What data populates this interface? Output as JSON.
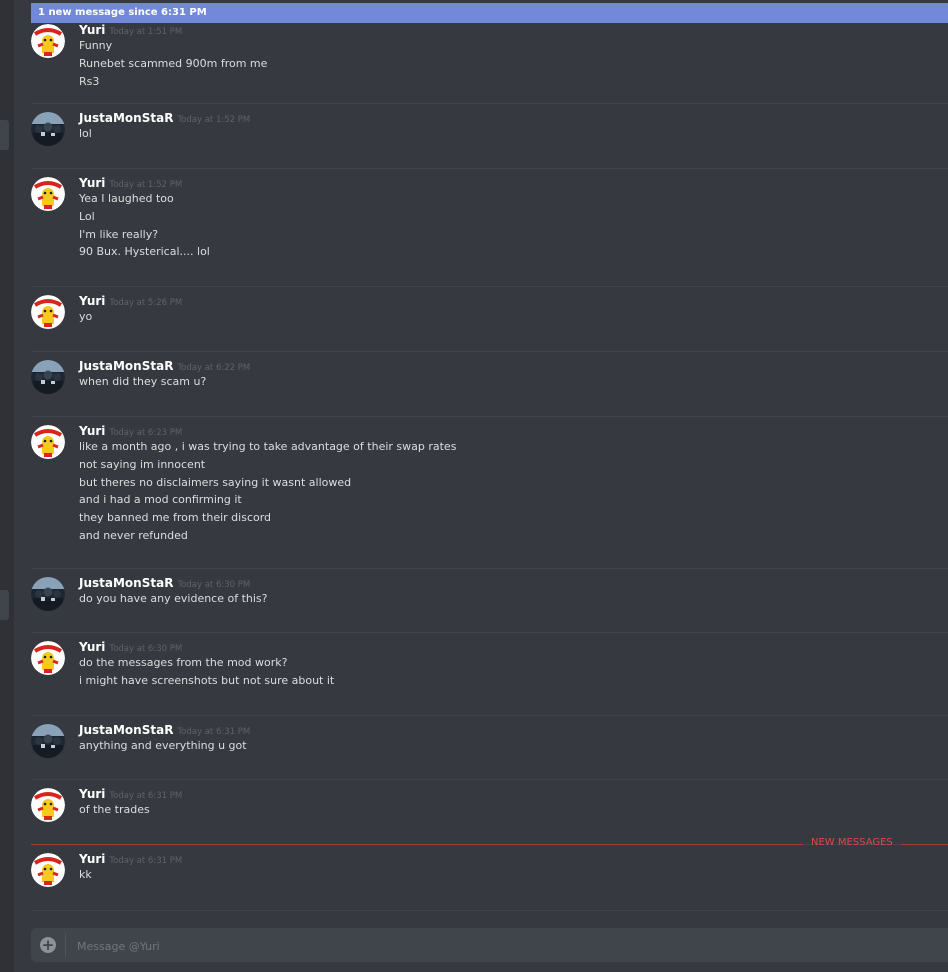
{
  "banner": {
    "text": "1 new message since 6:31 PM"
  },
  "colors": {
    "background": "#36393f",
    "banner": "#7289da",
    "new_messages": "#e0484a"
  },
  "messages": [
    {
      "author": "Yuri",
      "time": "Today at 1:51 PM",
      "lines": [
        "Funny",
        "Runebet scammed 900m from me",
        "Rs3"
      ]
    },
    {
      "author": "JustaMonStaR",
      "time": "Today at 1:52 PM",
      "lines": [
        "lol"
      ]
    },
    {
      "author": "Yuri",
      "time": "Today at 1:52 PM",
      "lines": [
        "Yea I laughed too",
        "Lol",
        "I'm like really?",
        "90 Bux. Hysterical.... lol"
      ]
    },
    {
      "author": "Yuri",
      "time": "Today at 5:26 PM",
      "lines": [
        "yo"
      ]
    },
    {
      "author": "JustaMonStaR",
      "time": "Today at 6:22 PM",
      "lines": [
        "when did they scam u?"
      ]
    },
    {
      "author": "Yuri",
      "time": "Today at 6:23 PM",
      "lines": [
        "like a month ago , i was trying to take advantage of their swap rates",
        "not saying im innocent",
        "but theres no disclaimers saying it wasnt allowed",
        "and i had a mod confirming it",
        "they banned me from their discord",
        "and never refunded"
      ]
    },
    {
      "author": "JustaMonStaR",
      "time": "Today at 6:30 PM",
      "lines": [
        "do you have any evidence of this?"
      ]
    },
    {
      "author": "Yuri",
      "time": "Today at 6:30 PM",
      "lines": [
        "do the messages from the mod work?",
        "i might have screenshots but not sure about it"
      ]
    },
    {
      "author": "JustaMonStaR",
      "time": "Today at 6:31 PM",
      "lines": [
        "anything and everything u got"
      ]
    },
    {
      "author": "Yuri",
      "time": "Today at 6:31 PM",
      "lines": [
        "of the trades"
      ]
    },
    {
      "author": "Yuri",
      "time": "Today at 6:31 PM",
      "lines": [
        "kk"
      ]
    }
  ],
  "new_messages_label": "NEW MESSAGES",
  "composer": {
    "placeholder": "Message @Yuri"
  }
}
